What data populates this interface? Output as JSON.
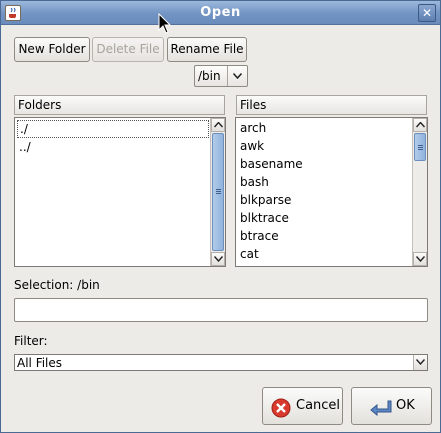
{
  "window": {
    "title": "Open"
  },
  "toolbar": {
    "new_folder": "New Folder",
    "delete_file": "Delete File",
    "rename_file": "Rename File"
  },
  "path_combo": {
    "value": "/bin"
  },
  "folders": {
    "header": "Folders",
    "items": [
      "./",
      "../"
    ]
  },
  "files": {
    "header": "Files",
    "items": [
      "arch",
      "awk",
      "basename",
      "bash",
      "blkparse",
      "blktrace",
      "btrace",
      "cat"
    ]
  },
  "selection": {
    "label": "Selection: /bin",
    "value": ""
  },
  "filter": {
    "label": "Filter:",
    "value": "All Files"
  },
  "buttons": {
    "cancel": "Cancel",
    "ok": "OK"
  },
  "icons": {
    "window": "java-cup-icon",
    "close": "close-icon",
    "cancel": "cancel-icon",
    "ok": "enter-arrow-icon",
    "dropdown": "chevron-down-icon"
  },
  "colors": {
    "titlebar": "#7294c3",
    "scroll_thumb": "#8fb2dd",
    "cancel_red": "#d83a2e",
    "ok_blue": "#5d86c4"
  }
}
